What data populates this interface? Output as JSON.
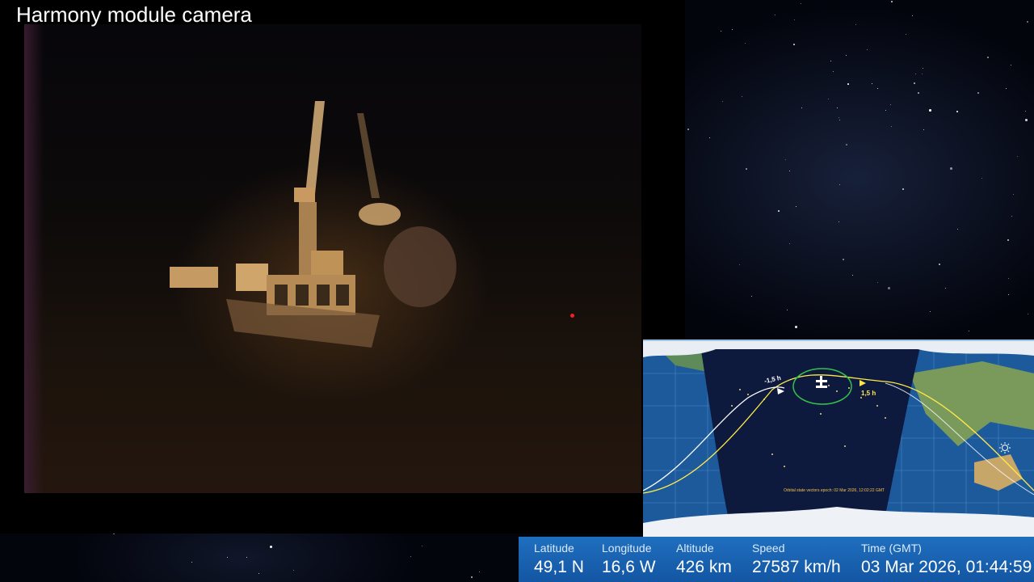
{
  "camera": {
    "title": "Harmony module camera"
  },
  "map": {
    "epoch_text": "Orbital state vectors epoch: 02 Mar 2026, 12:02:22 GMT",
    "orbit_label_past": "-1,5 h",
    "orbit_label_future": "1,5 h",
    "colors": {
      "ocean": "#1c5a9c",
      "night": "#0d1a3e",
      "past_orbit": "#ffffff",
      "future_orbit": "#ffe94a"
    },
    "icons": [
      "iss-icon",
      "sun-icon"
    ]
  },
  "telemetry": {
    "latitude": {
      "label": "Latitude",
      "value": "49,1 N"
    },
    "longitude": {
      "label": "Longitude",
      "value": "16,6 W"
    },
    "altitude": {
      "label": "Altitude",
      "value": "426 km"
    },
    "speed": {
      "label": "Speed",
      "value": "27587 km/h"
    },
    "time": {
      "label": "Time (GMT)",
      "value": "03 Mar 2026, 01:44:59"
    }
  }
}
